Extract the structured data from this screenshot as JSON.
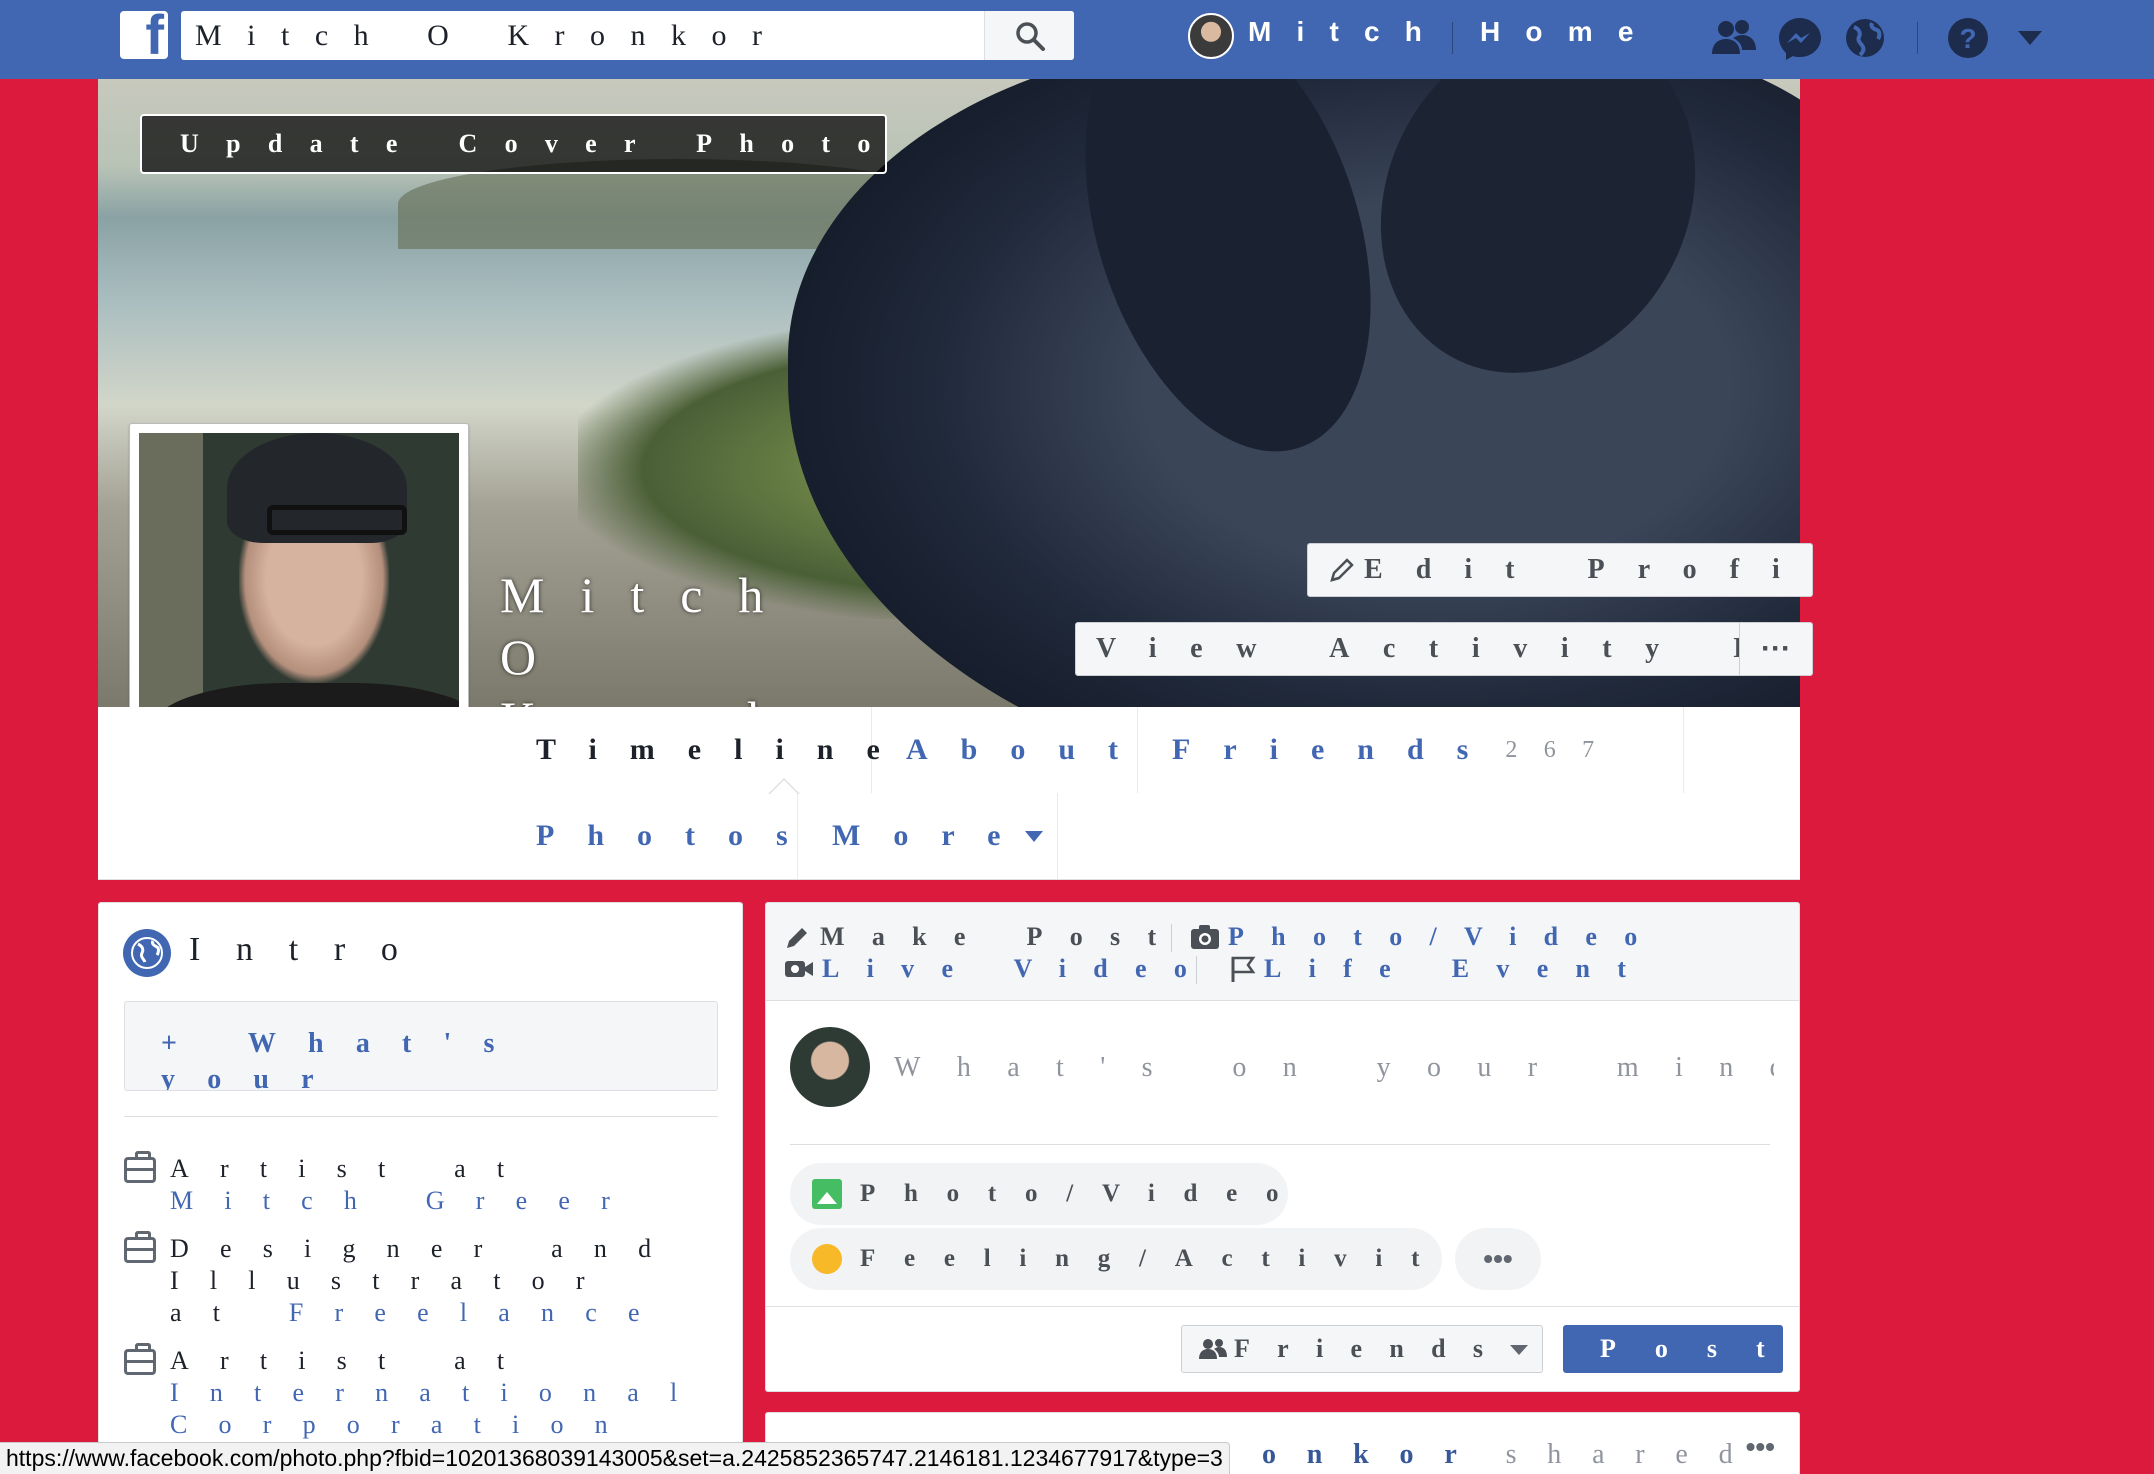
{
  "header": {
    "search_value": "Mitch O Kronkor",
    "profile_name": "Mitch",
    "home_label": "Home"
  },
  "cover": {
    "update_label": "Update Cover Photo",
    "profile_name": "Mitch O Kronkor",
    "edit_profile_label": "Edit Profile",
    "activity_log_label": "View Activity Log",
    "more_label": "···"
  },
  "nav": {
    "tabs": [
      {
        "label": "Timeline"
      },
      {
        "label": "About"
      },
      {
        "label": "Friends",
        "count": "267"
      },
      {
        "label": "Photos"
      },
      {
        "label": "More"
      }
    ]
  },
  "intro": {
    "title": "Intro",
    "bio_prompt": "+ What's your favorite quote?",
    "work": [
      {
        "prefix": "Artist at",
        "org": "Mitch Greer"
      },
      {
        "prefix": "Designer and Illustrator at",
        "org": "Freelance"
      },
      {
        "prefix": "Artist at",
        "org": "International Corporation"
      }
    ]
  },
  "composer": {
    "tabs": [
      "Make Post",
      "Photo/Video",
      "Live Video",
      "Life Event"
    ],
    "placeholder": "What's on your mind?",
    "photo_video_label": "Photo/Video",
    "feeling_label": "Feeling/Activity",
    "more_label": "•••",
    "audience_label": "Friends",
    "post_label": "Post"
  },
  "story": {
    "author_fragment": "onkor",
    "action": "shared",
    "more_label": "•••"
  },
  "status_bar": {
    "url": "https://www.facebook.com/photo.php?fbid=10201368039143005&set=a.2425852365747.2146181.1234677917&type=3"
  },
  "colors": {
    "brand_blue": "#4267b2",
    "page_background": "#dc1a3e"
  }
}
